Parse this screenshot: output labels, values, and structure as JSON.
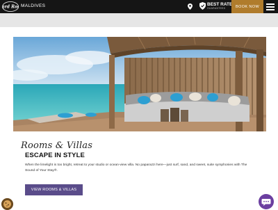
{
  "header": {
    "logo_text": "Hard Rock",
    "brand_sub": "MALDIVES",
    "best_rate_main": "BEST RATE",
    "best_rate_sub": "GUARANTEED",
    "book_now_label": "BOOK NOW",
    "icons": [
      "map-pin-icon",
      "shield-icon",
      "menu-icon"
    ]
  },
  "hero": {
    "image": "overwater-villa-daybed"
  },
  "section": {
    "script_title": "Rooms & Villas",
    "heading": "ESCAPE IN STYLE",
    "description": "When the limelight is too bright, retreat to your studio or ocean-view villa. No paparazzi here—just surf, sand, and sweet, suite symphonies with The Sound of Your Stay®.",
    "cta_label": "VIEW ROOMS & VILLAS"
  },
  "widgets": {
    "cookie_icon": "cookie-icon",
    "chat_icon": "chat-icon"
  },
  "colors": {
    "topbar": "#151515",
    "book_now": "#b07c2c",
    "cta": "#5a4c8a",
    "chat": "#6b3fa0"
  }
}
